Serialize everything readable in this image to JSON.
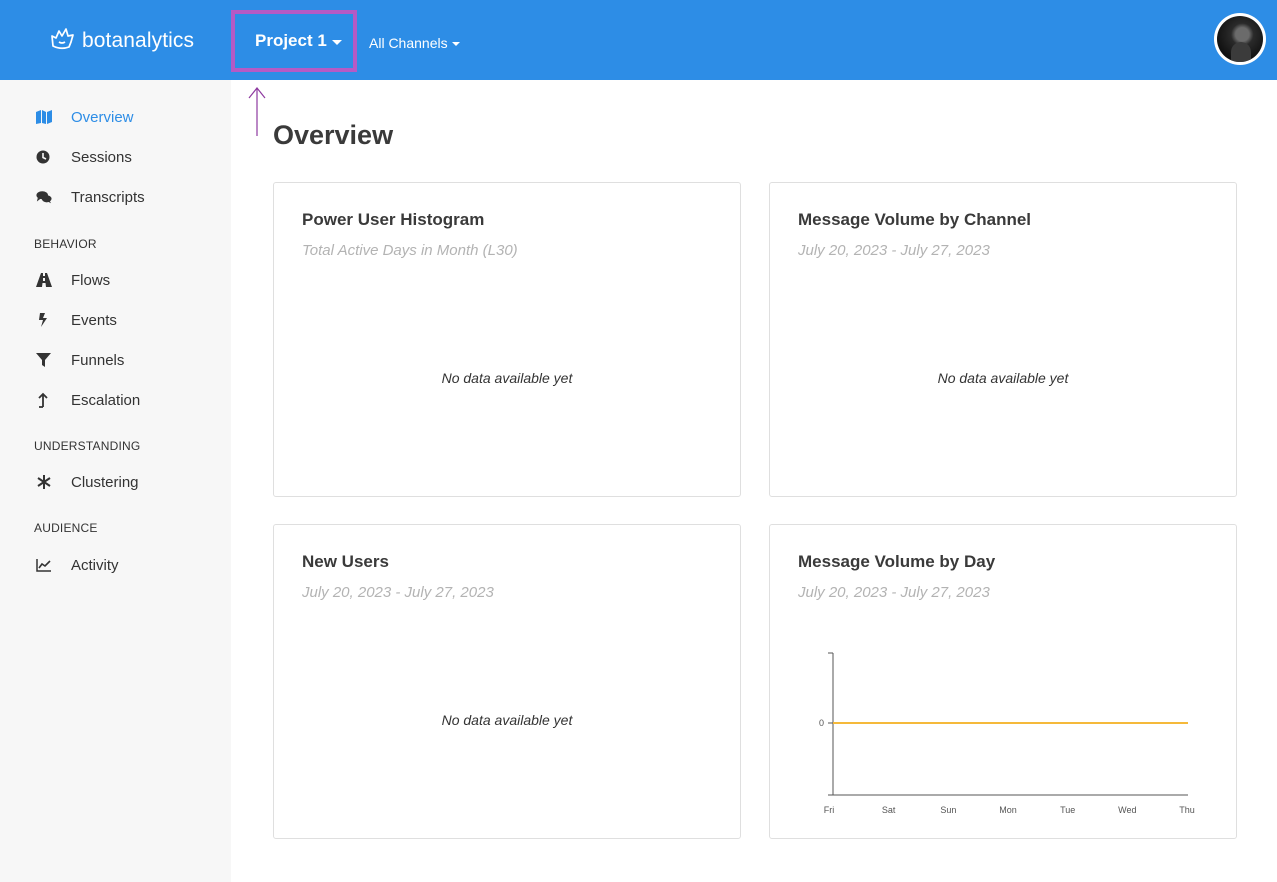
{
  "header": {
    "brand": "botanalytics",
    "project_label": "Project 1",
    "channels_label": "All Channels"
  },
  "sidebar": {
    "items": [
      {
        "label": "Overview",
        "icon": "map-icon",
        "active": true
      },
      {
        "label": "Sessions",
        "icon": "clock-icon"
      },
      {
        "label": "Transcripts",
        "icon": "chat-bubbles-icon"
      }
    ],
    "sections": [
      {
        "title": "BEHAVIOR",
        "items": [
          {
            "label": "Flows",
            "icon": "road-icon"
          },
          {
            "label": "Events",
            "icon": "bolt-icon"
          },
          {
            "label": "Funnels",
            "icon": "funnel-icon"
          },
          {
            "label": "Escalation",
            "icon": "arrow-up-icon"
          }
        ]
      },
      {
        "title": "UNDERSTANDING",
        "items": [
          {
            "label": "Clustering",
            "icon": "asterisk-icon"
          }
        ]
      },
      {
        "title": "AUDIENCE",
        "items": [
          {
            "label": "Activity",
            "icon": "line-chart-icon"
          }
        ]
      }
    ]
  },
  "main": {
    "title": "Overview",
    "cards": [
      {
        "title": "Power User Histogram",
        "subtitle": "Total Active Days in Month (L30)",
        "empty": "No data available yet"
      },
      {
        "title": "Message Volume by Channel",
        "subtitle": "July 20, 2023 - July 27, 2023",
        "empty": "No data available yet"
      },
      {
        "title": "New Users",
        "subtitle": "July 20, 2023 - July 27, 2023",
        "empty": "No data available yet"
      },
      {
        "title": "Message Volume by Day",
        "subtitle": "July 20, 2023 - July 27, 2023"
      }
    ]
  },
  "colors": {
    "header_bg": "#2d8de6",
    "active_nav": "#2d8de6",
    "highlight_box": "#b55ac5",
    "chart_line": "#f5b93a"
  },
  "chart_data": {
    "type": "line",
    "categories": [
      "Fri",
      "Sat",
      "Sun",
      "Mon",
      "Tue",
      "Wed",
      "Thu"
    ],
    "series": [
      {
        "values": [
          0,
          0,
          0,
          0,
          0,
          0,
          0
        ]
      }
    ],
    "yticks": [
      "0"
    ],
    "title": "",
    "xlabel": "",
    "ylabel": ""
  }
}
